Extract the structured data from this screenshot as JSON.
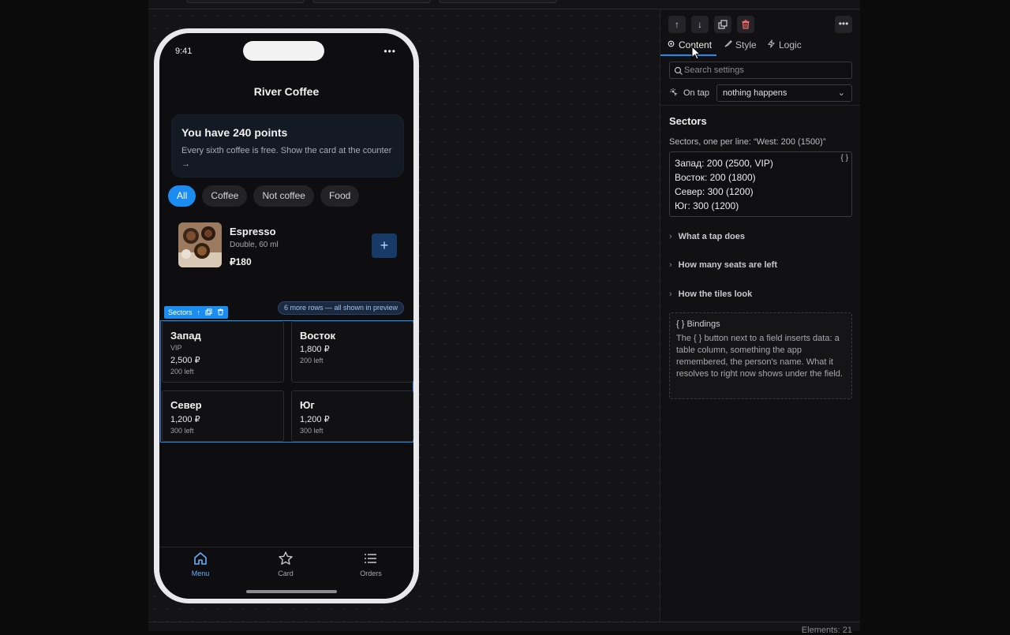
{
  "status_bar": {
    "time": "9:41",
    "dots": "•••"
  },
  "app": {
    "title": "River Coffee"
  },
  "points": {
    "title": "You have 240 points",
    "description": "Every sixth coffee is free. Show the card at the counter →"
  },
  "chips": [
    {
      "label": "All",
      "active": true
    },
    {
      "label": "Coffee",
      "active": false
    },
    {
      "label": "Not coffee",
      "active": false
    },
    {
      "label": "Food",
      "active": false
    }
  ],
  "product": {
    "name": "Espresso",
    "subtitle": "Double, 60 ml",
    "price": "₽180",
    "add_label": "+"
  },
  "selection": {
    "tag_label": "Sectors",
    "more_rows": "6 more rows — all shown in preview"
  },
  "tiles": [
    {
      "name": "Запад",
      "vip": "VIP",
      "price": "2,500 ₽",
      "left": "200 left"
    },
    {
      "name": "Восток",
      "vip": "",
      "price": "1,800 ₽",
      "left": "200 left"
    },
    {
      "name": "Север",
      "vip": "",
      "price": "1,200 ₽",
      "left": "300 left"
    },
    {
      "name": "Юг",
      "vip": "",
      "price": "1,200 ₽",
      "left": "300 left"
    }
  ],
  "tabbar": [
    {
      "label": "Menu",
      "icon": "home-icon",
      "active": true
    },
    {
      "label": "Card",
      "icon": "star-icon",
      "active": false
    },
    {
      "label": "Orders",
      "icon": "list-icon",
      "active": false
    }
  ],
  "inspector": {
    "tabs": [
      {
        "label": "Content",
        "icon": "gear-icon",
        "active": true
      },
      {
        "label": "Style",
        "icon": "brush-icon",
        "active": false
      },
      {
        "label": "Logic",
        "icon": "bolt-icon",
        "active": false
      }
    ],
    "search_placeholder": "Search settings",
    "on_tap_label": "On tap",
    "on_tap_value": "nothing happens",
    "section_title": "Sectors",
    "section_hint": "Sectors, one per line: “West: 200 (1500)”",
    "sector_lines": [
      "Запад: 200 (2500, VIP)",
      "Восток: 200 (1800)",
      "Север: 300 (1200)",
      "Юг: 300 (1200)"
    ],
    "bind_button": "{ }",
    "accordions": [
      {
        "label": "What a tap does"
      },
      {
        "label": "How many seats are left"
      },
      {
        "label": "How the tiles look"
      }
    ],
    "bindings": {
      "title": "{ } Bindings",
      "text": "The { } button next to a field inserts data: a table column, something the app remembered, the person's name. What it resolves to right now shows under the field."
    }
  },
  "footer": {
    "status": "Elements: 21"
  },
  "colors": {
    "accent": "#1b8cf0",
    "danger": "#ff6b6b"
  }
}
